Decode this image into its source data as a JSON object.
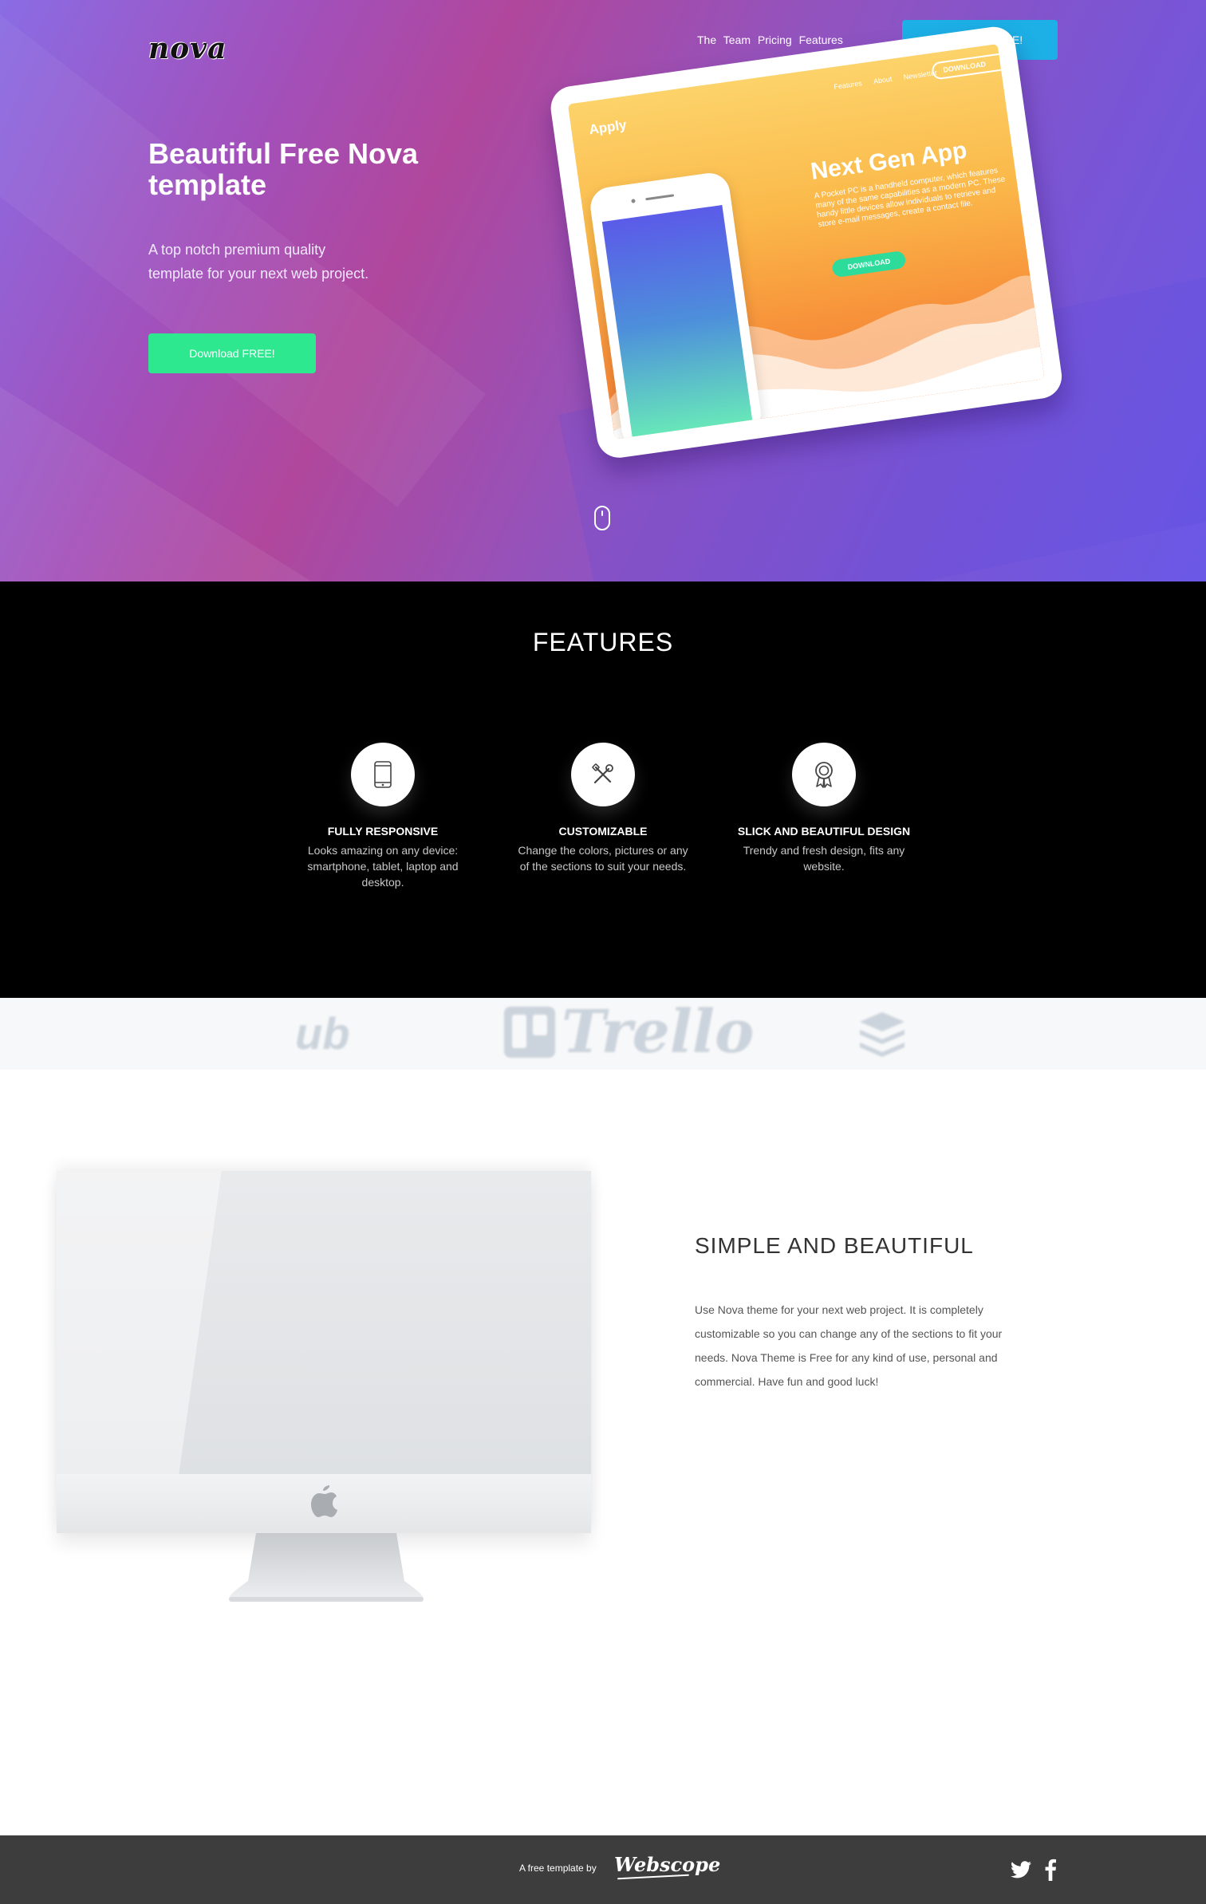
{
  "header": {
    "logo": "nova",
    "nav_links": [
      "The",
      "Team",
      "Pricing",
      "Features"
    ],
    "cta_label": "Download FREE!"
  },
  "hero": {
    "title": "Beautiful Free Nova template",
    "subtitle": "A top notch premium quality template for your next web project.",
    "cta_label": "Download FREE!",
    "mockup": {
      "brand": "Apply",
      "menu": [
        "Features",
        "About",
        "Newsletter"
      ],
      "download_outline": "DOWNLOAD",
      "title": "Next Gen App",
      "text": "A Pocket PC is a handheld computer, which features many of the same capabilities as a modern PC. These handy little devices allow individuals to retrieve and store e-mail messages, create a contact file.",
      "download_button": "DOWNLOAD"
    }
  },
  "features": {
    "title": "FEATURES",
    "items": [
      {
        "icon": "mobile-phone-icon",
        "title": "FULLY RESPONSIVE",
        "text": "Looks amazing on any device: smartphone, tablet, laptop and desktop."
      },
      {
        "icon": "tools-icon",
        "title": "CUSTOMIZABLE",
        "text": "Change the colors, pictures or any of the sections to suit your needs."
      },
      {
        "icon": "award-ribbon-icon",
        "title": "SLICK AND BEAUTIFUL DESIGN",
        "text": "Trendy and fresh design, fits any website."
      }
    ]
  },
  "logos": {
    "items": [
      "ub",
      "Trello",
      "stack-layers-icon"
    ]
  },
  "simple": {
    "title": "SIMPLE AND BEAUTIFUL",
    "text": "Use Nova theme for your next web project. It is completely customizable so you can change any of the sections to fit your needs. Nova Theme is Free for any kind of use, personal and commercial. Have fun and good luck!"
  },
  "footer": {
    "text": "A free template by",
    "brand": "Webscope",
    "social": [
      "twitter-icon",
      "facebook-icon"
    ]
  },
  "colors": {
    "nav_cta": "#1cb0e6",
    "hero_cta": "#2de88f",
    "features_bg": "#000000",
    "footer_bg": "#3d3d3d"
  }
}
